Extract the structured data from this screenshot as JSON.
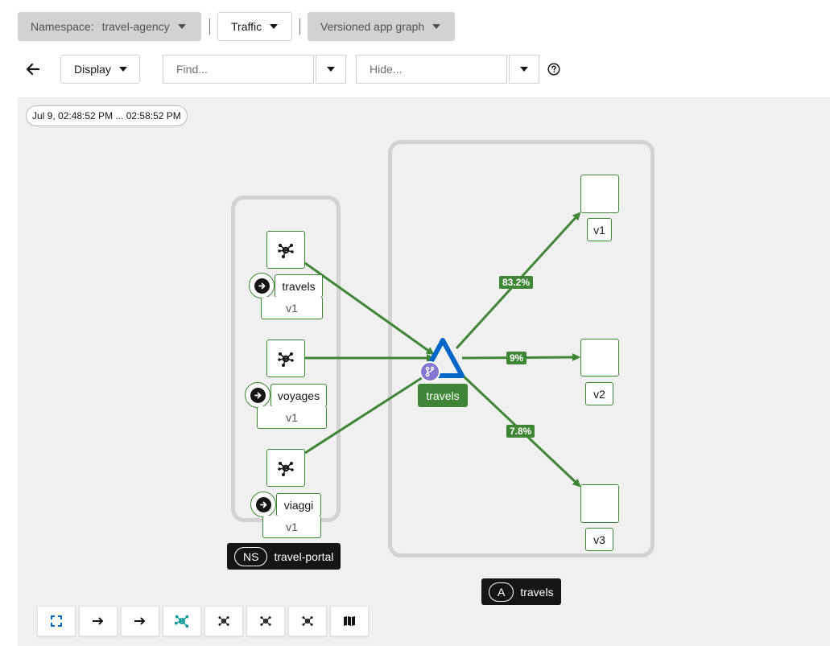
{
  "toolbar": {
    "namespace_label": "Namespace:",
    "namespace_value": "travel-agency",
    "traffic_label": "Traffic",
    "graph_type_label": "Versioned app graph",
    "display_label": "Display",
    "find_placeholder": "Find...",
    "hide_placeholder": "Hide..."
  },
  "graph": {
    "time_range": "Jul 9, 02:48:52 PM ... 02:58:52 PM",
    "namespace_box": {
      "badge": "NS",
      "name": "travel-portal"
    },
    "app_box": {
      "badge": "A",
      "name": "travels"
    },
    "source_services": [
      {
        "name": "travels",
        "version": "v1"
      },
      {
        "name": "voyages",
        "version": "v1"
      },
      {
        "name": "viaggi",
        "version": "v1"
      }
    ],
    "target_service": "travels",
    "target_versions": [
      "v1",
      "v2",
      "v3"
    ],
    "edge_labels": [
      "83.2%",
      "9%",
      "7.8%"
    ]
  },
  "colors": {
    "edge": "#3e8635",
    "service_triangle": "#0066cc",
    "virtual_service_badge": "#8476d1"
  },
  "icons": {
    "back": "arrow-left-icon",
    "help": "question-circle-icon",
    "service_node": "service-topology-icon",
    "gateway": "arrow-circle-right-icon",
    "virtual_service": "code-branch-icon"
  }
}
